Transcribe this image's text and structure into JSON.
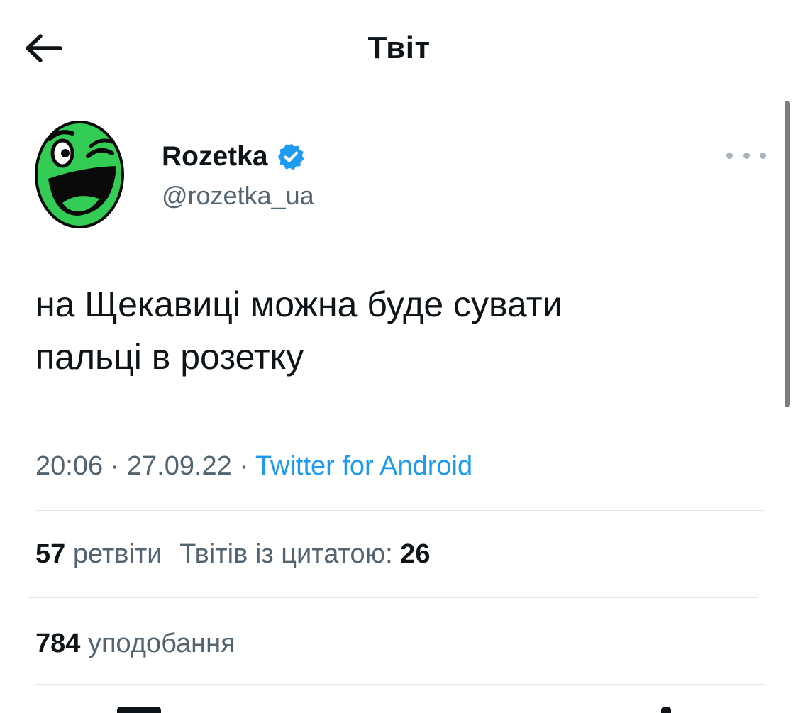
{
  "header": {
    "title": "Твіт",
    "back_icon": "arrow-left-icon"
  },
  "tweet": {
    "author": {
      "name": "Rozetka",
      "handle": "@rozetka_ua",
      "verified": true,
      "avatar_icon": "rozetka-smiley-logo",
      "avatar_color": "#33cc55"
    },
    "more_icon": "more-horizontal-icon",
    "text": "на Щекавиці можна буде сувати\nпальці в розетку",
    "time": "20:06",
    "separator": "·",
    "date": "27.09.22",
    "source": "Twitter for Android",
    "stats": {
      "retweets_count": "57",
      "retweets_label": "ретвіти",
      "quotes_label": "Твітів із цитатою:",
      "quotes_count": "26",
      "likes_count": "784",
      "likes_label": "уподобання"
    }
  },
  "colors": {
    "text": "#0f1419",
    "secondary": "#536471",
    "link": "#1d9bf0",
    "verified": "#1d9bf0",
    "divider": "#e4e7ea"
  }
}
